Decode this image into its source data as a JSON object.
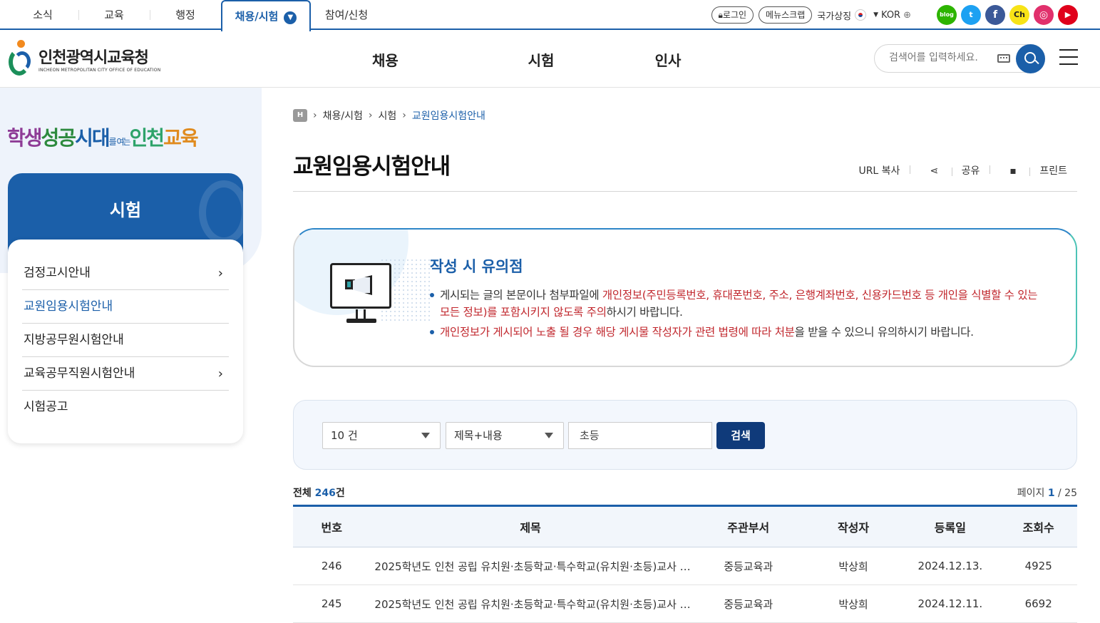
{
  "topnav": {
    "items": [
      "소식",
      "교육",
      "행정",
      "채용/시험",
      "참여/신청"
    ],
    "active_index": 3
  },
  "util": {
    "login": "로그인",
    "menu_scrap": "메뉴스크랩",
    "national_symbol": "국가상징",
    "language": "KOR",
    "sns": [
      {
        "name": "blog-icon",
        "label": "blog",
        "color": "#2db400"
      },
      {
        "name": "twitter-icon",
        "label": "t",
        "color": "#1da1f2"
      },
      {
        "name": "facebook-icon",
        "label": "f",
        "color": "#3b5998"
      },
      {
        "name": "kakao-channel-icon",
        "label": "Ch",
        "color": "#f7e317"
      },
      {
        "name": "instagram-icon",
        "label": "◎",
        "color": "#e1306c"
      },
      {
        "name": "youtube-icon",
        "label": "▶",
        "color": "#e0001b"
      }
    ]
  },
  "header": {
    "logo_name": "인천광역시교육청",
    "logo_sub": "INCHEON METROPOLITAN CITY OFFICE OF EDUCATION",
    "gnb": [
      "채용",
      "시험",
      "인사"
    ],
    "search_placeholder": "검색어를 입력하세요."
  },
  "sidebar": {
    "slogan": {
      "part1": "학생",
      "part2": "성공",
      "part3": "시대",
      "small": "를 여는",
      "part4": "인천",
      "part5": "교육"
    },
    "title": "시험",
    "items": [
      {
        "label": "검정고시안내",
        "arrow": "›"
      },
      {
        "label": "교원임용시험안내",
        "arrow": ""
      },
      {
        "label": "지방공무원시험안내",
        "arrow": ""
      },
      {
        "label": "교육공무직원시험안내",
        "arrow": "›"
      },
      {
        "label": "시험공고",
        "arrow": ""
      }
    ],
    "active_index": 1
  },
  "breadcrumb": {
    "home": "H",
    "items": [
      "채용/시험",
      "시험",
      "교원임용시험안내"
    ]
  },
  "page": {
    "title": "교원임용시험안내",
    "tools": [
      "URL 복사",
      "공유",
      "프린트"
    ]
  },
  "notice": {
    "title": "작성 시 유의점",
    "line1_a": "게시되는 글의 본문이나 첨부파일에 ",
    "line1_red": "개인정보(주민등록번호, 휴대폰번호, 주소, 은행계좌번호, 신용카드번호 등 개인을 식별할 수 있는 모든 정보)를 포함시키지 않도록 주의",
    "line1_b": "하시기 바랍니다.",
    "line2_red": "개인정보가 게시되어 노출 될 경우 해당 게시물 작성자가 관련 법령에 따라 처분",
    "line2_b": "을 받을 수 있으니 유의하시기 바랍니다."
  },
  "search": {
    "count_select": "10 건",
    "field_select": "제목+내용",
    "keyword": "초등",
    "button": "검색"
  },
  "list": {
    "total_label": "전체 ",
    "total_count": "246",
    "total_unit": "건",
    "page_label": "페이지 ",
    "page_current": "1",
    "page_total": " / 25",
    "columns": [
      "번호",
      "제목",
      "주관부서",
      "작성자",
      "등록일",
      "조회수"
    ],
    "rows": [
      {
        "no": "246",
        "title": "2025학년도 인천 공립 유치원·초등학교·특수학교(유치원·초등)교사 …",
        "dept": "중등교육과",
        "author": "박상희",
        "date": "2024.12.13.",
        "views": "4925"
      },
      {
        "no": "245",
        "title": "2025학년도 인천 공립 유치원·초등학교·특수학교(유치원·초등)교사 …",
        "dept": "중등교육과",
        "author": "박상희",
        "date": "2024.12.11.",
        "views": "6692"
      }
    ]
  },
  "colors": {
    "primary": "#1b5fa9",
    "accent_red": "#c1272d",
    "button_dark": "#0f3a7a"
  }
}
